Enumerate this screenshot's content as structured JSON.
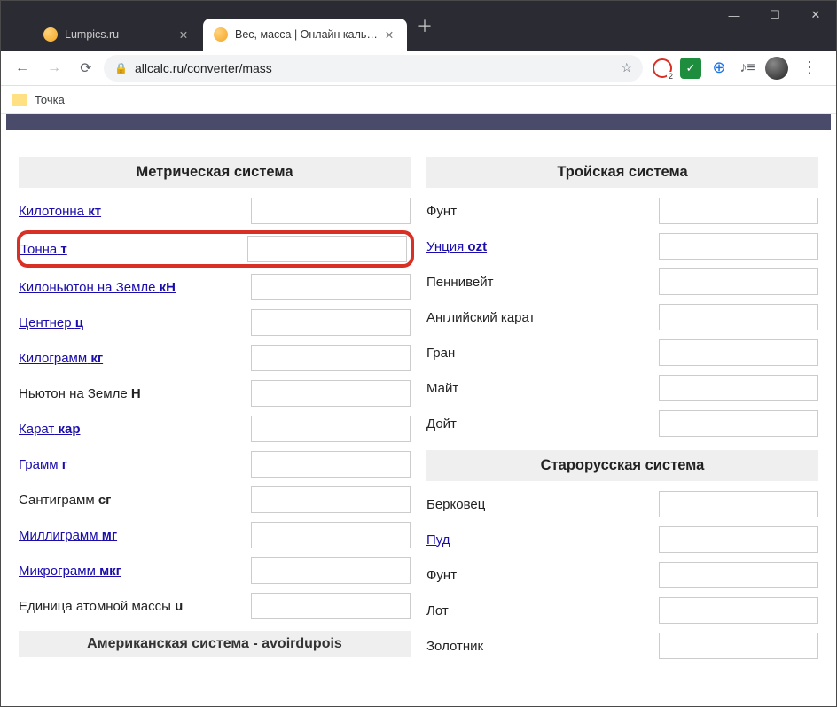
{
  "window": {
    "tabs": [
      {
        "label": "Lumpics.ru",
        "active": false
      },
      {
        "label": "Вес, масса | Онлайн калькулятор",
        "active": true
      }
    ]
  },
  "nav": {
    "url_display": "allcalc.ru/converter/mass",
    "host": "allcalc.ru",
    "path": "/converter/mass"
  },
  "bookmarks": [
    {
      "label": "Точка"
    }
  ],
  "left": {
    "header": "Метрическая система",
    "rows": [
      {
        "name": "Килотонна",
        "abbr": "кт",
        "link": true
      },
      {
        "name": "Тонна",
        "abbr": "т",
        "link": true,
        "highlight": true
      },
      {
        "name": "Килоньютон на Земле",
        "abbr": "кН",
        "link": true
      },
      {
        "name": "Центнер",
        "abbr": "ц",
        "link": true
      },
      {
        "name": "Килограмм",
        "abbr": "кг",
        "link": true
      },
      {
        "name": "Ньютон на Земле",
        "abbr": "Н",
        "link": false
      },
      {
        "name": "Карат",
        "abbr": "кар",
        "link": true
      },
      {
        "name": "Грамм",
        "abbr": "г",
        "link": true
      },
      {
        "name": "Сантиграмм",
        "abbr": "сг",
        "link": false
      },
      {
        "name": "Миллиграмм",
        "abbr": "мг",
        "link": true
      },
      {
        "name": "Микрограмм",
        "abbr": "мкг",
        "link": true
      },
      {
        "name": "Единица атомной массы",
        "abbr": "u",
        "link": false
      }
    ],
    "partial_next": "Американская система - avoirdupois"
  },
  "right": {
    "sections": [
      {
        "header": "Тройская система",
        "rows": [
          {
            "name": "Фунт",
            "abbr": "",
            "link": false
          },
          {
            "name": "Унция",
            "abbr": "ozt",
            "link": true
          },
          {
            "name": "Пеннивейт",
            "abbr": "",
            "link": false
          },
          {
            "name": "Английский карат",
            "abbr": "",
            "link": false
          },
          {
            "name": "Гран",
            "abbr": "",
            "link": false
          },
          {
            "name": "Майт",
            "abbr": "",
            "link": false
          },
          {
            "name": "Дойт",
            "abbr": "",
            "link": false
          }
        ]
      },
      {
        "header": "Старорусская система",
        "rows": [
          {
            "name": "Берковец",
            "abbr": "",
            "link": false
          },
          {
            "name": "Пуд",
            "abbr": "",
            "link": true
          },
          {
            "name": "Фунт",
            "abbr": "",
            "link": false
          },
          {
            "name": "Лот",
            "abbr": "",
            "link": false
          },
          {
            "name": "Золотник",
            "abbr": "",
            "link": false
          }
        ]
      }
    ]
  }
}
